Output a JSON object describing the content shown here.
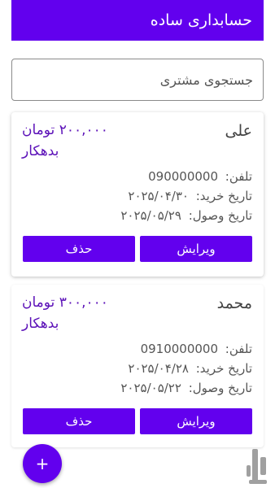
{
  "app": {
    "title": "حسابداری ساده"
  },
  "search": {
    "placeholder": "جستجوی مشتری"
  },
  "labels": {
    "phone": "تلفن:",
    "purchase_date": "تاریخ خرید:",
    "receive_date": "تاریخ وصول:",
    "edit_button": "ویرایش",
    "delete_button": "حذف"
  },
  "customers": [
    {
      "name": "علی",
      "amount": "۲۰۰,۰۰۰ تومان",
      "status": "بدهکار",
      "phone": "090000000",
      "purchase_date": "۲۰۲۵/۰۴/۳۰",
      "receive_date": "۲۰۲۵/۰۵/۲۹"
    },
    {
      "name": "محمد",
      "amount": "۳۰۰,۰۰۰ تومان",
      "status": "بدهکار",
      "phone": "0910000000",
      "purchase_date": "۲۰۲۵/۰۴/۲۸",
      "receive_date": "۲۰۲۵/۰۵/۲۲"
    }
  ],
  "fab": {
    "label": "+"
  },
  "colors": {
    "primary": "#6200ee",
    "amount_text": "#5b10b8"
  },
  "icons": {
    "fab": "plus-icon",
    "watermark": "app-watermark-logo"
  }
}
